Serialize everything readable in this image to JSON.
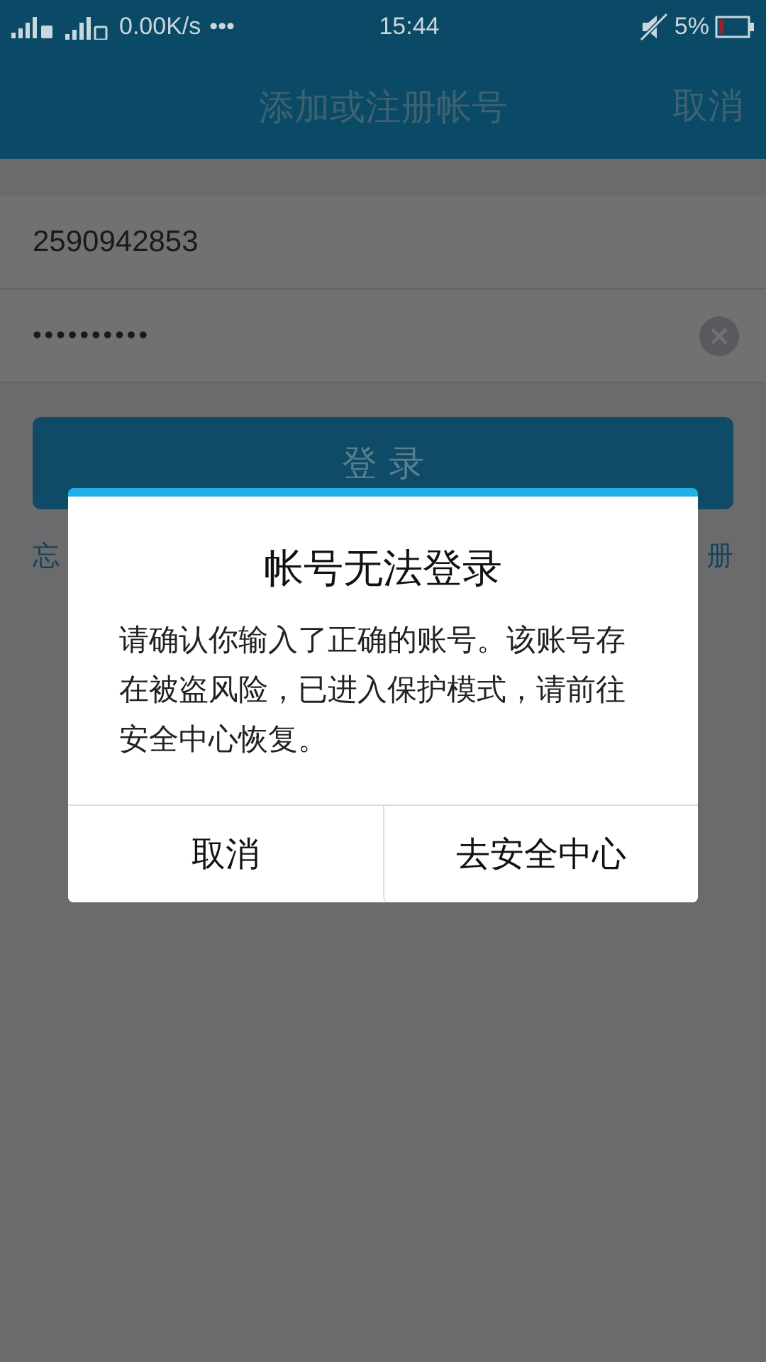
{
  "status_bar": {
    "speed": "0.00K/s",
    "more": "•••",
    "time": "15:44",
    "battery": "5%"
  },
  "header": {
    "title": "添加或注册帐号",
    "action": "取消"
  },
  "fields": [
    {
      "kind": "text",
      "value": "2590942853"
    },
    {
      "kind": "password",
      "value": "••••••••••"
    }
  ],
  "login_button": "登 录",
  "links": [
    "忘",
    "册"
  ],
  "dialog": {
    "title": "帐号无法登录",
    "message": "请确认你输入了正确的账号。该账号存在被盗风险，已进入保护模式，请前往安全中心恢复。",
    "buttons": [
      "取消",
      "去安全中心"
    ]
  }
}
